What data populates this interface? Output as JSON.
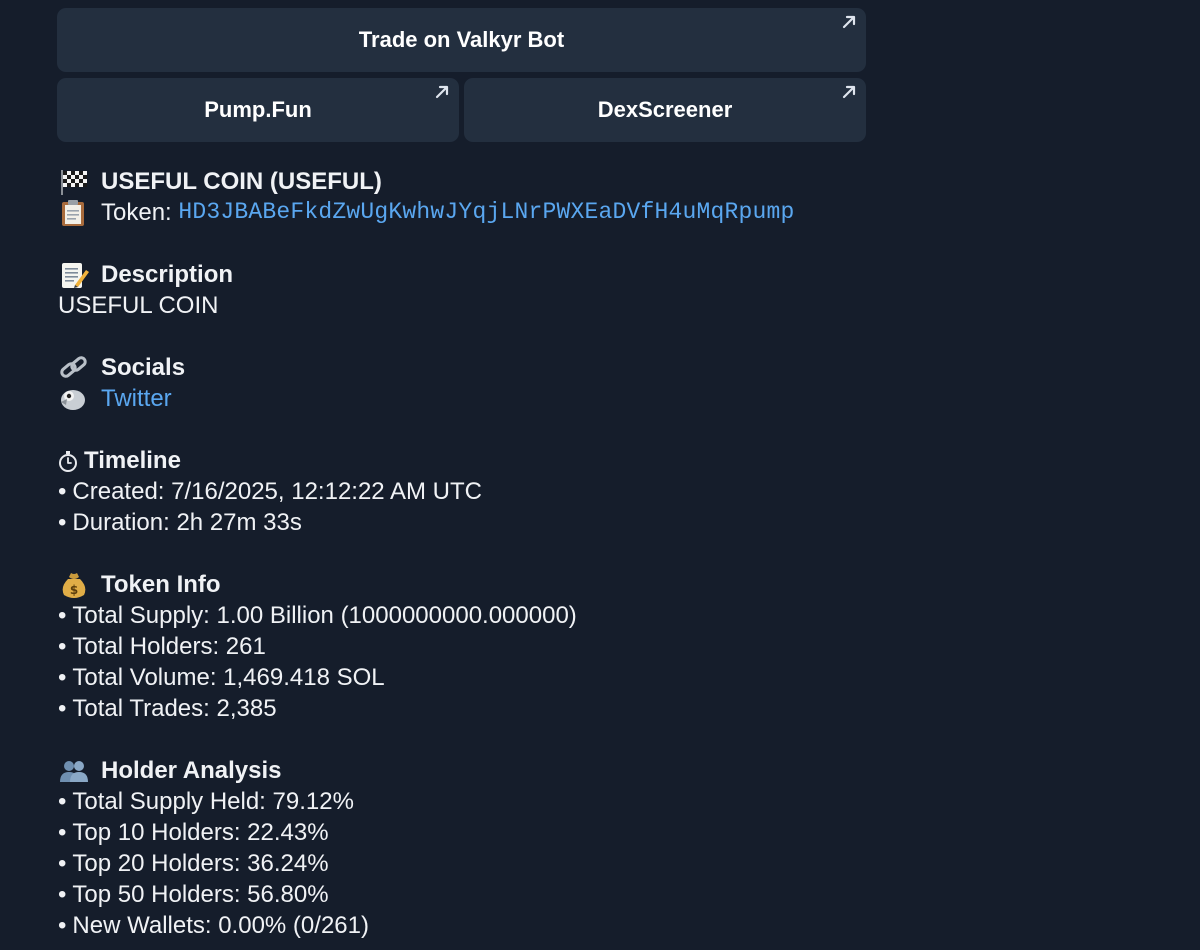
{
  "buttons": {
    "trade": "Trade on Valkyr Bot",
    "pump": "Pump.Fun",
    "dex": "DexScreener"
  },
  "token": {
    "title": "USEFUL COIN (USEFUL)",
    "token_label": "Token: ",
    "address": "HD3JBABeFkdZwUgKwhwJYqjLNrPWXEaDVfH4uMqRpump"
  },
  "description": {
    "heading": "Description",
    "text": "USEFUL COIN"
  },
  "socials": {
    "heading": "Socials",
    "twitter": "Twitter"
  },
  "timeline": {
    "heading": "Timeline",
    "created": "Created: 7/16/2025, 12:12:22 AM UTC",
    "duration": "Duration: 2h 27m 33s"
  },
  "token_info": {
    "heading": "Token Info",
    "items": [
      "Total Supply: 1.00 Billion (1000000000.000000)",
      "Total Holders: 261",
      "Total Volume: 1,469.418 SOL",
      "Total Trades: 2,385"
    ]
  },
  "holder_analysis": {
    "heading": "Holder Analysis",
    "items": [
      "Total Supply Held: 79.12%",
      "Top 10 Holders: 22.43%",
      "Top 20 Holders: 36.24%",
      "Top 50 Holders: 56.80%",
      "New Wallets: 0.00% (0/261)"
    ]
  },
  "bullet": "•",
  "colors": {
    "background": "#151d2b",
    "button_bg": "#232f3f",
    "link": "#5aa7f0",
    "text": "#f0f2f5"
  },
  "icons": {
    "title": "checkered-flag-icon",
    "token": "clipboard-icon",
    "description": "memo-icon",
    "socials": "link-icon",
    "twitter": "bird-icon",
    "timeline": "stopwatch-icon",
    "token_info": "money-bag-icon",
    "holder_analysis": "people-icon",
    "external": "external-arrow-icon"
  }
}
